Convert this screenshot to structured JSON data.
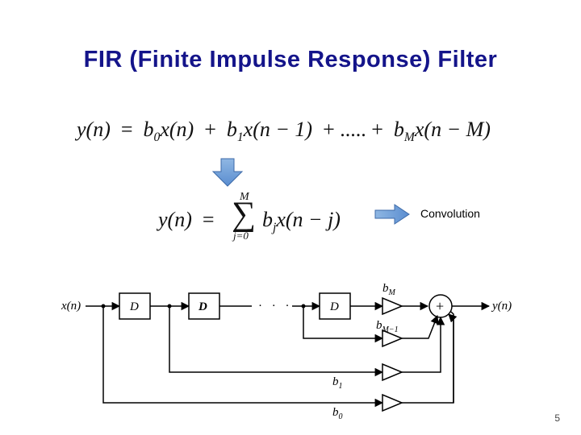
{
  "title": "FIR (Finite Impulse Response) Filter",
  "equation1": {
    "lhs": "y(n)",
    "eq": "=",
    "terms": [
      "b",
      "x(n)",
      "+",
      "b",
      "x(n − 1)",
      "+ ..... +",
      "b",
      "x(n − M)"
    ],
    "sub0": "0",
    "sub1": "1",
    "subM": "M"
  },
  "equation2": {
    "lhs": "y(n)",
    "eq": "=",
    "sigma_top": "M",
    "sigma_bot": "j=0",
    "body_b": "b",
    "body_sub": "j",
    "body_rest": "x(n − j)"
  },
  "convolution_label": "Convolution",
  "diagram": {
    "input": "x(n)",
    "delay": "D",
    "delay_bold": "D",
    "dots": "· · ·",
    "output": "y(n)",
    "gain_bM": "b",
    "gain_bM_sub": "M",
    "gain_bM1": "b",
    "gain_bM1_sub": "M−1",
    "gain_b1": "b",
    "gain_b1_sub": "1",
    "gain_b0": "b",
    "gain_b0_sub": "0",
    "plus": "+"
  },
  "page_number": "5",
  "chart_data": {
    "type": "diagram",
    "title": "FIR (Finite Impulse Response) Filter",
    "equation_expanded": "y(n) = b0·x(n) + b1·x(n−1) + … + bM·x(n−M)",
    "equation_summation": "y(n) = Σ_{j=0}^{M} b_j · x(n − j)",
    "annotation": "Convolution",
    "blocks": [
      {
        "id": "in",
        "type": "input",
        "label": "x(n)"
      },
      {
        "id": "d1",
        "type": "delay",
        "label": "D"
      },
      {
        "id": "d2",
        "type": "delay",
        "label": "D"
      },
      {
        "id": "dots",
        "type": "ellipsis",
        "label": "…"
      },
      {
        "id": "dM",
        "type": "delay",
        "label": "D"
      },
      {
        "id": "gM",
        "type": "gain",
        "label": "b_M"
      },
      {
        "id": "gM1",
        "type": "gain",
        "label": "b_{M-1}"
      },
      {
        "id": "g1",
        "type": "gain",
        "label": "b_1"
      },
      {
        "id": "g0",
        "type": "gain",
        "label": "b_0"
      },
      {
        "id": "sum",
        "type": "adder",
        "label": "+"
      },
      {
        "id": "out",
        "type": "output",
        "label": "y(n)"
      }
    ],
    "edges": [
      [
        "in",
        "d1"
      ],
      [
        "d1",
        "d2"
      ],
      [
        "d2",
        "dots"
      ],
      [
        "dots",
        "dM"
      ],
      [
        "dM",
        "gM"
      ],
      [
        "gM",
        "sum"
      ],
      [
        "between_dots_dM_tap",
        "gM1"
      ],
      [
        "gM1",
        "sum"
      ],
      [
        "between_d1_d2_tap",
        "g1"
      ],
      [
        "g1",
        "sum"
      ],
      [
        "in_tap",
        "g0"
      ],
      [
        "g0",
        "sum"
      ],
      [
        "sum",
        "out"
      ]
    ]
  }
}
